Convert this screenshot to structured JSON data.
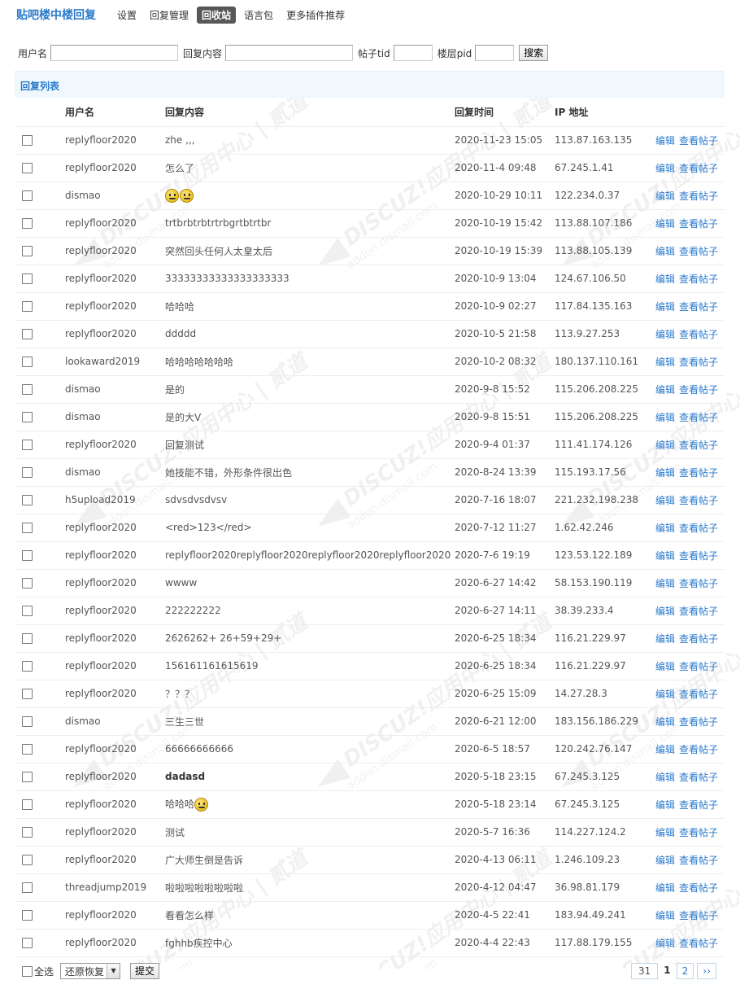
{
  "nav": {
    "brand": "贴吧楼中楼回复",
    "items": [
      "设置",
      "回复管理",
      "回收站",
      "语言包",
      "更多插件推荐"
    ],
    "active_index": 2
  },
  "search": {
    "user_label": "用户名",
    "content_label": "回复内容",
    "tid_label": "帖子tid",
    "pid_label": "楼层pid",
    "button": "搜索"
  },
  "list": {
    "title": "回复列表",
    "headers": [
      "用户名",
      "回复内容",
      "回复时间",
      "IP 地址"
    ],
    "edit_label": "编辑",
    "view_label": "查看帖子",
    "rows": [
      {
        "user": "replyfloor2020",
        "content": "zhe ,,,",
        "time": "2020-11-23 15:05",
        "ip": "113.87.163.135"
      },
      {
        "user": "replyfloor2020",
        "content": "怎么了",
        "time": "2020-11-4 09:48",
        "ip": "67.245.1.41"
      },
      {
        "user": "dismao",
        "content": "",
        "emoji": 2,
        "time": "2020-10-29 10:11",
        "ip": "122.234.0.37"
      },
      {
        "user": "replyfloor2020",
        "content": "trtbrbtrbtrtrbgrtbtrtbr",
        "time": "2020-10-19 15:42",
        "ip": "113.88.107.186"
      },
      {
        "user": "replyfloor2020",
        "content": "突然回头任何人太皇太后",
        "time": "2020-10-19 15:39",
        "ip": "113.88.105.139"
      },
      {
        "user": "replyfloor2020",
        "content": "33333333333333333333",
        "time": "2020-10-9 13:04",
        "ip": "124.67.106.50"
      },
      {
        "user": "replyfloor2020",
        "content": "哈哈哈",
        "time": "2020-10-9 02:27",
        "ip": "117.84.135.163"
      },
      {
        "user": "replyfloor2020",
        "content": "ddddd",
        "time": "2020-10-5 21:58",
        "ip": "113.9.27.253"
      },
      {
        "user": "lookaward2019",
        "content": "哈哈哈哈哈哈哈",
        "time": "2020-10-2 08:32",
        "ip": "180.137.110.161"
      },
      {
        "user": "dismao",
        "content": "是的",
        "time": "2020-9-8 15:52",
        "ip": "115.206.208.225"
      },
      {
        "user": "dismao",
        "content": "是的大V",
        "time": "2020-9-8 15:51",
        "ip": "115.206.208.225"
      },
      {
        "user": "replyfloor2020",
        "content": "回复测试",
        "time": "2020-9-4 01:37",
        "ip": "111.41.174.126"
      },
      {
        "user": "dismao",
        "content": "她技能不错，外形条件很出色",
        "time": "2020-8-24 13:39",
        "ip": "115.193.17.56"
      },
      {
        "user": "h5upload2019",
        "content": "sdvsdvsdvsv",
        "time": "2020-7-16 18:07",
        "ip": "221.232.198.238"
      },
      {
        "user": "replyfloor2020",
        "content": "<red>123</red>",
        "time": "2020-7-12 11:27",
        "ip": "1.62.42.246"
      },
      {
        "user": "replyfloor2020",
        "content": "replyfloor2020replyfloor2020replyfloor2020replyfloor2020",
        "time": "2020-7-6 19:19",
        "ip": "123.53.122.189"
      },
      {
        "user": "replyfloor2020",
        "content": "wwww",
        "time": "2020-6-27 14:42",
        "ip": "58.153.190.119"
      },
      {
        "user": "replyfloor2020",
        "content": "222222222",
        "time": "2020-6-27 14:11",
        "ip": "38.39.233.4"
      },
      {
        "user": "replyfloor2020",
        "content": "2626262+ 26+59+29+",
        "time": "2020-6-25 18:34",
        "ip": "116.21.229.97"
      },
      {
        "user": "replyfloor2020",
        "content": "156161161615619",
        "time": "2020-6-25 18:34",
        "ip": "116.21.229.97"
      },
      {
        "user": "replyfloor2020",
        "content": "？？？",
        "time": "2020-6-25 15:09",
        "ip": "14.27.28.3"
      },
      {
        "user": "dismao",
        "content": "三生三世",
        "time": "2020-6-21 12:00",
        "ip": "183.156.186.229"
      },
      {
        "user": "replyfloor2020",
        "content": "66666666666",
        "time": "2020-6-5 18:57",
        "ip": "120.242.76.147"
      },
      {
        "user": "replyfloor2020",
        "content": "dadasd",
        "bold": true,
        "time": "2020-5-18 23:15",
        "ip": "67.245.3.125"
      },
      {
        "user": "replyfloor2020",
        "content": "哈哈哈",
        "emoji": 1,
        "time": "2020-5-18 23:14",
        "ip": "67.245.3.125"
      },
      {
        "user": "replyfloor2020",
        "content": "测试",
        "time": "2020-5-7 16:36",
        "ip": "114.227.124.2"
      },
      {
        "user": "replyfloor2020",
        "content": "广大师生倒是告诉",
        "time": "2020-4-13 06:11",
        "ip": "1.246.109.23"
      },
      {
        "user": "threadjump2019",
        "content": "啦啦啦啦啦啦啦啦",
        "time": "2020-4-12 04:47",
        "ip": "36.98.81.179"
      },
      {
        "user": "replyfloor2020",
        "content": "看看怎么样",
        "time": "2020-4-5 22:41",
        "ip": "183.94.49.241"
      },
      {
        "user": "replyfloor2020",
        "content": "fghhb疾控中心",
        "time": "2020-4-4 22:43",
        "ip": "117.88.179.155"
      }
    ]
  },
  "footer": {
    "select_all": "全选",
    "action_selected": "还原恢复",
    "submit": "提交"
  },
  "pager": {
    "total": "31",
    "current": "1",
    "next_page": "2",
    "next": "››"
  },
  "watermark": {
    "line1": "DISCUZ!应用中心 | 贰道",
    "line2": "addon.dismall.com"
  }
}
